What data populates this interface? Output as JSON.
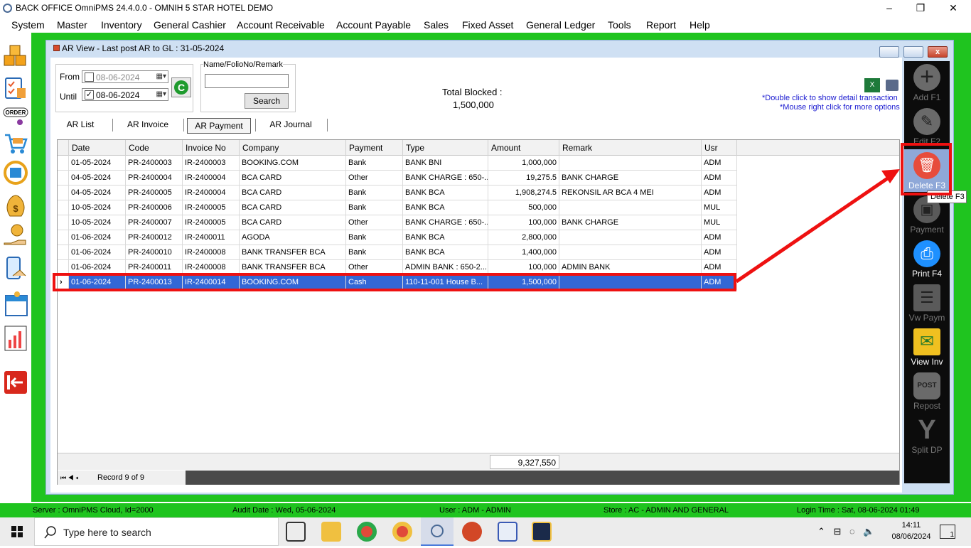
{
  "window": {
    "title": "BACK OFFICE OmniPMS 24.4.0.0 - OMNIH 5 STAR HOTEL DEMO",
    "minimize": "–",
    "maximize": "❐",
    "close": "✕"
  },
  "menu": [
    "System",
    "Master",
    "Inventory",
    "General Cashier",
    "Account Receivable",
    "Account Payable",
    "Sales",
    "Fixed Asset",
    "General Ledger",
    "Tools",
    "Report",
    "Help"
  ],
  "left_toolbar_icons": [
    "boxes-icon",
    "clipboard-icon",
    "order-icon",
    "cart-icon",
    "sync-icon",
    "money-bag-icon",
    "hand-money-icon",
    "mobile-payment-icon",
    "calendar-icon",
    "chart-icon",
    "exit-icon"
  ],
  "left_toolbar_order_label": "ORDER",
  "child": {
    "title": "AR View - Last post AR to GL : 31-05-2024",
    "close_glyph": "x"
  },
  "filters": {
    "from_label": "From",
    "until_label": "Until",
    "from_value": "08-06-2024",
    "until_value": "08-06-2024",
    "from_checked": false,
    "until_checked": true,
    "check_glyph": "✓",
    "dropdown_glyph": "▦▾",
    "refresh_glyph": "C",
    "search_group_label": "Name/FolioNo/Remark",
    "search_value": "",
    "search_button": "Search"
  },
  "summary": {
    "total_blocked_label": "Total Blocked :",
    "total_blocked_value": "1,500,000"
  },
  "hints": {
    "line1": "*Double click to show detail transaction",
    "line2": "*Mouse right click for more options"
  },
  "tabs": [
    {
      "label": "AR List",
      "active": false
    },
    {
      "label": "AR Invoice",
      "active": false
    },
    {
      "label": "AR Payment",
      "active": true
    },
    {
      "label": "AR Journal",
      "active": false
    }
  ],
  "grid": {
    "columns": [
      "Date",
      "Code",
      "Invoice No",
      "Company",
      "Payment",
      "Type",
      "Amount",
      "Remark",
      "Usr"
    ],
    "rows": [
      [
        "01-05-2024",
        "PR-2400003",
        "IR-2400003",
        "BOOKING.COM",
        "Bank",
        "BANK BNI",
        "1,000,000",
        "",
        "ADM"
      ],
      [
        "04-05-2024",
        "PR-2400004",
        "IR-2400004",
        "BCA CARD",
        "Other",
        "BANK CHARGE : 650-...",
        "19,275.5",
        "BANK CHARGE",
        "ADM"
      ],
      [
        "04-05-2024",
        "PR-2400005",
        "IR-2400004",
        "BCA CARD",
        "Bank",
        "BANK BCA",
        "1,908,274.5",
        "REKONSIL AR BCA 4 MEI",
        "ADM"
      ],
      [
        "10-05-2024",
        "PR-2400006",
        "IR-2400005",
        "BCA CARD",
        "Bank",
        "BANK BCA",
        "500,000",
        "",
        "MUL"
      ],
      [
        "10-05-2024",
        "PR-2400007",
        "IR-2400005",
        "BCA CARD",
        "Other",
        "BANK CHARGE : 650-...",
        "100,000",
        "BANK CHARGE",
        "MUL"
      ],
      [
        "01-06-2024",
        "PR-2400012",
        "IR-2400011",
        "AGODA",
        "Bank",
        "BANK BCA",
        "2,800,000",
        "",
        "ADM"
      ],
      [
        "01-06-2024",
        "PR-2400010",
        "IR-2400008",
        "BANK TRANSFER BCA",
        "Bank",
        "BANK BCA",
        "1,400,000",
        "",
        "ADM"
      ],
      [
        "01-06-2024",
        "PR-2400011",
        "IR-2400008",
        "BANK TRANSFER BCA",
        "Other",
        "ADMIN BANK : 650-2...",
        "100,000",
        "ADMIN BANK",
        "ADM"
      ],
      [
        "01-06-2024",
        "PR-2400013",
        "IR-2400014",
        "BOOKING.COM",
        "Cash",
        "110-11-001 House B...",
        "1,500,000",
        "",
        "ADM"
      ]
    ],
    "selected_row": 9,
    "row_pointer_glyph": "›",
    "total_amount": "9,327,550",
    "record_text": "Record 9 of 9",
    "nav_glyphs": "⏮ ◀ ◂"
  },
  "right_toolbar": [
    {
      "label": "Add F1",
      "icon": "plus-icon",
      "glyph": "+",
      "enabled": false
    },
    {
      "label": "Edit F2",
      "icon": "edit-icon",
      "glyph": "✎",
      "enabled": false
    },
    {
      "label": "Delete F3",
      "icon": "trash-icon",
      "glyph": "🗑",
      "enabled": true
    },
    {
      "label": "Payment",
      "icon": "wallet-icon",
      "glyph": "▣",
      "enabled": false
    },
    {
      "label": "Print F4",
      "icon": "printer-icon",
      "glyph": "⎙",
      "enabled": true
    },
    {
      "label": "Vw Paym",
      "icon": "list-icon",
      "glyph": "☰",
      "enabled": false
    },
    {
      "label": "View Inv",
      "icon": "envelope-icon",
      "glyph": "✉",
      "enabled": true
    },
    {
      "label": "Repost",
      "icon": "post-icon",
      "glyph": "POST",
      "enabled": false
    },
    {
      "label": "Split DP",
      "icon": "split-icon",
      "glyph": "Y",
      "enabled": false
    }
  ],
  "tooltip": "Delete F3",
  "status": {
    "server": "Server : OmniPMS Cloud, Id=2000",
    "audit": "Audit Date : Wed, 05-06-2024",
    "user": "User : ADM - ADMIN",
    "store": "Store : AC - ADMIN AND GENERAL",
    "login": "Login Time : Sat, 08-06-2024 01:49"
  },
  "taskbar": {
    "search_placeholder": "Type here to search",
    "time": "14:11",
    "date": "08/06/2024",
    "apps": [
      "task-view-icon",
      "file-explorer-icon",
      "chrome-icon",
      "chrome-alt-icon",
      "omnipms-icon",
      "powerpoint-icon",
      "paint-icon",
      "app-icon"
    ],
    "tray": "⌃ ⊟ ◌ 🔈",
    "notification_count": "1"
  },
  "colors": {
    "frame_green": "#1fc41f",
    "selection_blue": "#3367d6",
    "annotation_red": "#ee1111",
    "delete_red": "#e74c3c",
    "print_blue": "#1e90ff"
  }
}
